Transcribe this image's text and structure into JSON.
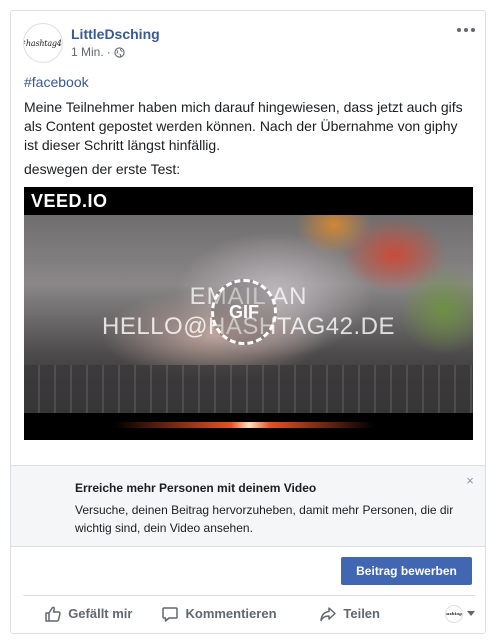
{
  "post": {
    "author": "LittleDsching",
    "avatar_text": "#hashtag42",
    "timestamp": "1 Min.",
    "separator": "·",
    "privacy_icon": "globe-icon",
    "hashtag": "#facebook",
    "text_paragraph_1": "Meine Teilnehmer haben mich darauf hingewiesen, dass jetzt auch gifs als Content gepostet werden können. Nach der Übernahme von giphy ist dieser Schritt längst hinfällig.",
    "text_paragraph_2": "deswegen der erste Test:"
  },
  "media": {
    "watermark": "VEED.IO",
    "overlay_line_1": "EMAIL AN",
    "overlay_line_2": "HELLO@HASHTAG42.DE",
    "badge": "GIF"
  },
  "promo": {
    "title": "Erreiche mehr Personen mit deinem Video",
    "body": "Versuche, deinen Beitrag hervorzuheben, damit mehr Personen, die dir wichtig sind, dein Video ansehen.",
    "close_label": "×",
    "button_label": "Beitrag bewerben"
  },
  "actions": {
    "like": "Gefällt mir",
    "comment": "Kommentieren",
    "share": "Teilen"
  },
  "colors": {
    "link": "#385898",
    "button": "#4267b2",
    "muted": "#606770"
  }
}
